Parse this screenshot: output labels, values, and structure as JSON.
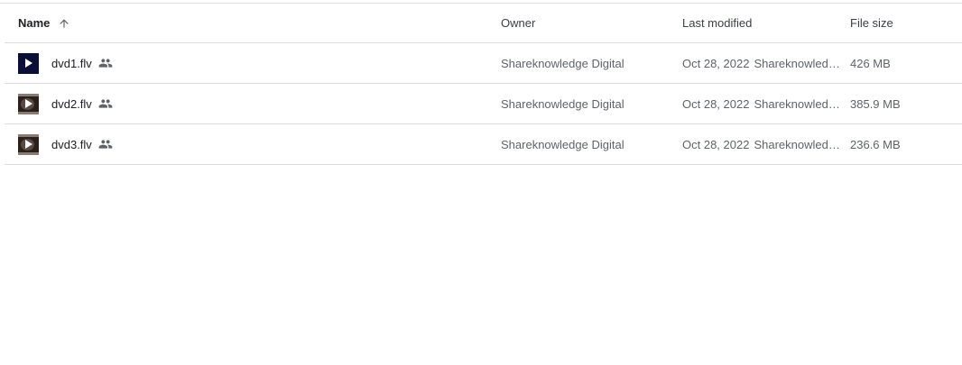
{
  "columns": {
    "name": "Name",
    "owner": "Owner",
    "modified": "Last modified",
    "size": "File size"
  },
  "files": [
    {
      "name": "dvd1.flv",
      "owner": "Shareknowledge Digital",
      "modified_date": "Oct 28, 2022",
      "modified_by": "Shareknowledge Digital",
      "size": "426 MB",
      "thumbnail": "play-dark"
    },
    {
      "name": "dvd2.flv",
      "owner": "Shareknowledge Digital",
      "modified_date": "Oct 28, 2022",
      "modified_by": "Shareknowledge Digital",
      "size": "385.9 MB",
      "thumbnail": "play-photo"
    },
    {
      "name": "dvd3.flv",
      "owner": "Shareknowledge Digital",
      "modified_date": "Oct 28, 2022",
      "modified_by": "Shareknowledge Digital",
      "size": "236.6 MB",
      "thumbnail": "play-photo"
    }
  ],
  "icons": {
    "sort": "arrow-up-icon",
    "shared": "people-icon"
  }
}
